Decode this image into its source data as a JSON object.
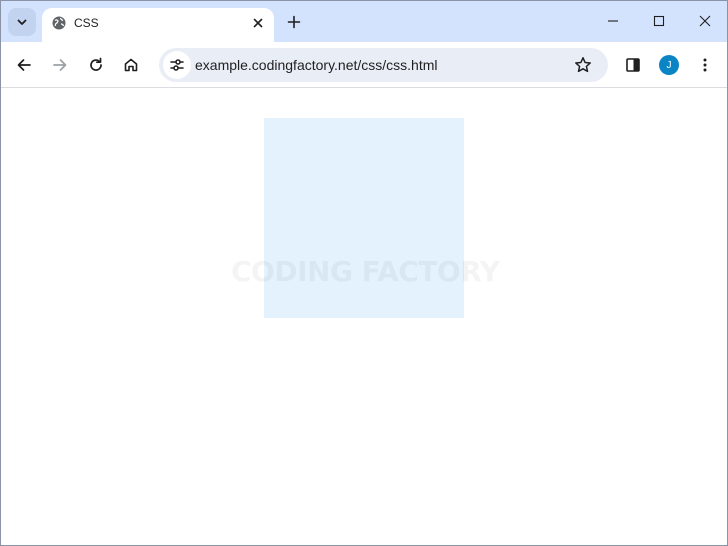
{
  "tab": {
    "title": "CSS",
    "favicon": "globe-icon"
  },
  "omnibox": {
    "url": "example.codingfactory.net/css/css.html"
  },
  "profile": {
    "initial": "J",
    "color": "#0b84c6"
  },
  "page": {
    "box_color": "#e3f2fd",
    "watermark": "CODING FACTORY"
  },
  "colors": {
    "tabstrip": "#d3e3fd",
    "omnibox": "#e9eef6"
  }
}
